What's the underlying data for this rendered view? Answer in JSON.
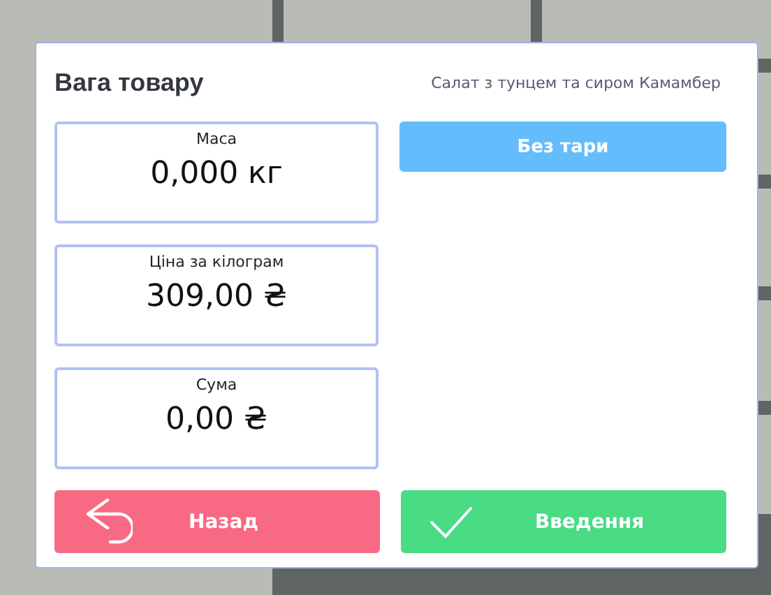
{
  "dialog": {
    "title": "Вага товару",
    "product": "Салат з тунцем та сиром Камамбер",
    "fields": [
      {
        "label": "Маса",
        "value": "0,000 кг"
      },
      {
        "label": "Ціна за кілограм",
        "value": "309,00 ₴"
      },
      {
        "label": "Сума",
        "value": "0,00 ₴"
      }
    ],
    "tare_button": "Без тари",
    "buttons": [
      {
        "kind": "back",
        "label": "Назад"
      },
      {
        "kind": "confirm",
        "label": "Введення"
      }
    ]
  }
}
